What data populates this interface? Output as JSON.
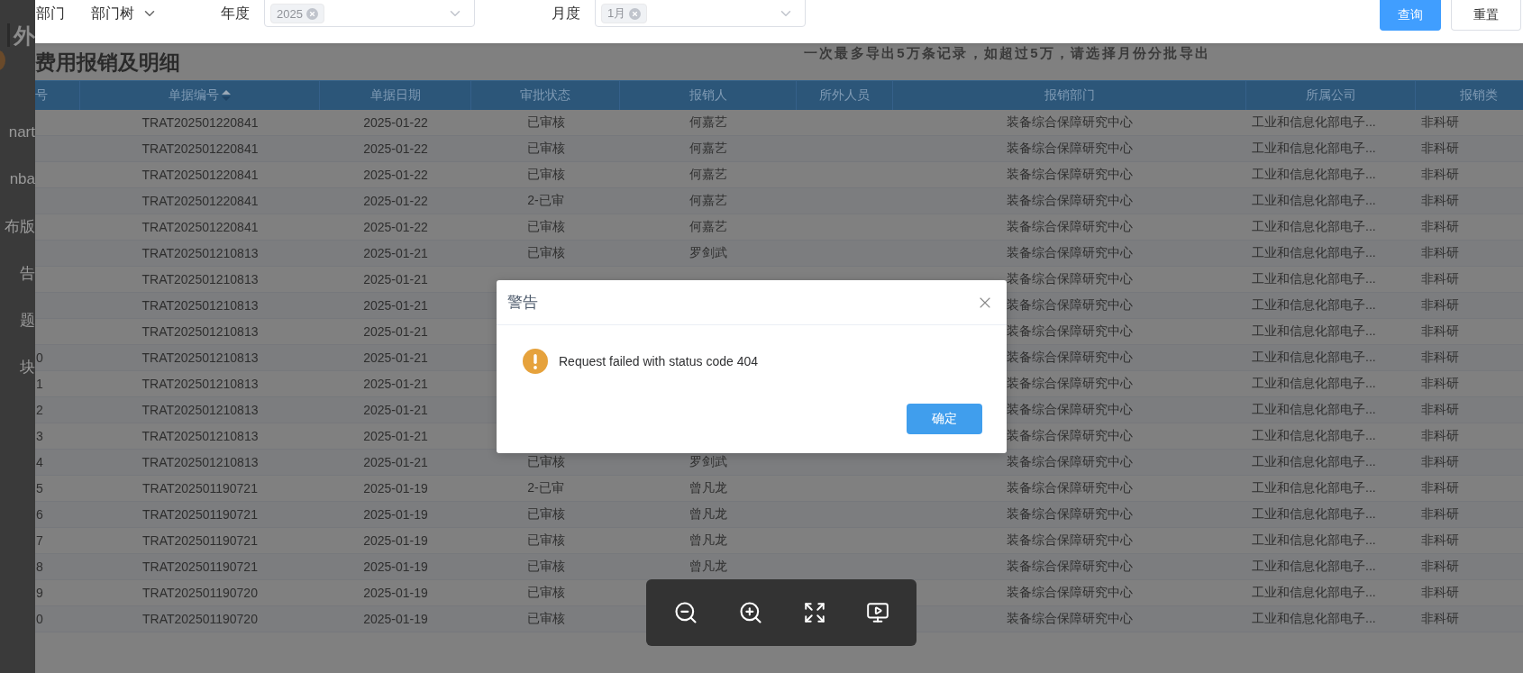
{
  "sidebar": {
    "logo_text": "外",
    "items": [
      "nart",
      "nba",
      "布版",
      "告",
      "题",
      "块"
    ]
  },
  "filters": [
    {
      "kind": "tree",
      "label": "部门",
      "value": "部门树"
    },
    {
      "kind": "select",
      "label": "年度",
      "tags": [
        "2025"
      ]
    },
    {
      "kind": "select",
      "label": "月度",
      "tags": [
        "1月"
      ]
    }
  ],
  "buttons": [
    {
      "label": "查询",
      "primary": true
    },
    {
      "label": "重置",
      "primary": false
    }
  ],
  "page": {
    "title": "费用报销及明细",
    "note": "一次最多导出5万条记录，如超过5万，请选择月份分批导出"
  },
  "table": {
    "columns": [
      {
        "label": "号"
      },
      {
        "label": "单据编号",
        "sort_ascending": true
      },
      {
        "label": "单据日期"
      },
      {
        "label": "审批状态"
      },
      {
        "label": "报销人"
      },
      {
        "label": "所外人员"
      },
      {
        "label": "报销部门"
      },
      {
        "label": "所属公司"
      },
      {
        "label": "报销类"
      }
    ],
    "rows": [
      {
        "number": "TRAT202501220841",
        "date": "2025-01-22",
        "status": "已审核",
        "person": "何嘉艺",
        "department": "装备综合保障研究中心",
        "company": "工业和信息化部电子...",
        "type": "非科研"
      },
      {
        "number": "TRAT202501220841",
        "date": "2025-01-22",
        "status": "已审核",
        "person": "何嘉艺",
        "department": "装备综合保障研究中心",
        "company": "工业和信息化部电子...",
        "type": "非科研"
      },
      {
        "number": "TRAT202501220841",
        "date": "2025-01-22",
        "status": "已审核",
        "person": "何嘉艺",
        "department": "装备综合保障研究中心",
        "company": "工业和信息化部电子...",
        "type": "非科研"
      },
      {
        "number": "TRAT202501220841",
        "date": "2025-01-22",
        "status": "2-已审",
        "person": "何嘉艺",
        "department": "装备综合保障研究中心",
        "company": "工业和信息化部电子...",
        "type": "非科研"
      },
      {
        "number": "TRAT202501220841",
        "date": "2025-01-22",
        "status": "已审核",
        "person": "何嘉艺",
        "department": "装备综合保障研究中心",
        "company": "工业和信息化部电子...",
        "type": "非科研"
      },
      {
        "number": "TRAT202501210813",
        "date": "2025-01-21",
        "status": "已审核",
        "person": "罗剑武",
        "department": "装备综合保障研究中心",
        "company": "工业和信息化部电子...",
        "type": "非科研"
      },
      {
        "number": "TRAT202501210813",
        "date": "2025-01-21",
        "department": "装备综合保障研究中心",
        "company": "工业和信息化部电子...",
        "type": "非科研"
      },
      {
        "number": "TRAT202501210813",
        "date": "2025-01-21",
        "department": "装备综合保障研究中心",
        "company": "工业和信息化部电子...",
        "type": "非科研"
      },
      {
        "number": "TRAT202501210813",
        "date": "2025-01-21",
        "department": "装备综合保障研究中心",
        "company": "工业和信息化部电子...",
        "type": "非科研"
      },
      {
        "index": "0",
        "number": "TRAT202501210813",
        "date": "2025-01-21",
        "department": "装备综合保障研究中心",
        "company": "工业和信息化部电子...",
        "type": "非科研"
      },
      {
        "index": "1",
        "number": "TRAT202501210813",
        "date": "2025-01-21",
        "department": "装备综合保障研究中心",
        "company": "工业和信息化部电子...",
        "type": "非科研"
      },
      {
        "index": "2",
        "number": "TRAT202501210813",
        "date": "2025-01-21",
        "department": "装备综合保障研究中心",
        "company": "工业和信息化部电子...",
        "type": "非科研"
      },
      {
        "index": "3",
        "number": "TRAT202501210813",
        "date": "2025-01-21",
        "department": "装备综合保障研究中心",
        "company": "工业和信息化部电子...",
        "type": "非科研"
      },
      {
        "index": "4",
        "number": "TRAT202501210813",
        "date": "2025-01-21",
        "status": "已审核",
        "person": "罗剑武",
        "department": "装备综合保障研究中心",
        "company": "工业和信息化部电子...",
        "type": "非科研"
      },
      {
        "index": "5",
        "number": "TRAT202501190721",
        "date": "2025-01-19",
        "status": "2-已审",
        "person": "曾凡龙",
        "department": "装备综合保障研究中心",
        "company": "工业和信息化部电子...",
        "type": "非科研"
      },
      {
        "index": "6",
        "number": "TRAT202501190721",
        "date": "2025-01-19",
        "status": "已审核",
        "person": "曾凡龙",
        "department": "装备综合保障研究中心",
        "company": "工业和信息化部电子...",
        "type": "非科研"
      },
      {
        "index": "7",
        "number": "TRAT202501190721",
        "date": "2025-01-19",
        "status": "已审核",
        "person": "曾凡龙",
        "department": "装备综合保障研究中心",
        "company": "工业和信息化部电子...",
        "type": "非科研"
      },
      {
        "index": "8",
        "number": "TRAT202501190721",
        "date": "2025-01-19",
        "status": "已审核",
        "person": "曾凡龙",
        "department": "装备综合保障研究中心",
        "company": "工业和信息化部电子...",
        "type": "非科研"
      },
      {
        "index": "9",
        "number": "TRAT202501190720",
        "date": "2025-01-19",
        "status": "已审核",
        "department": "装备综合保障研究中心",
        "company": "工业和信息化部电子...",
        "type": "非科研"
      },
      {
        "index": "0",
        "number": "TRAT202501190720",
        "date": "2025-01-19",
        "status": "已审核",
        "department": "装备综合保障研究中心",
        "company": "工业和信息化部电子...",
        "type": "非科研"
      }
    ]
  },
  "dialog": {
    "title": "警告",
    "message": "Request failed with status code 404",
    "confirm": "确定"
  }
}
